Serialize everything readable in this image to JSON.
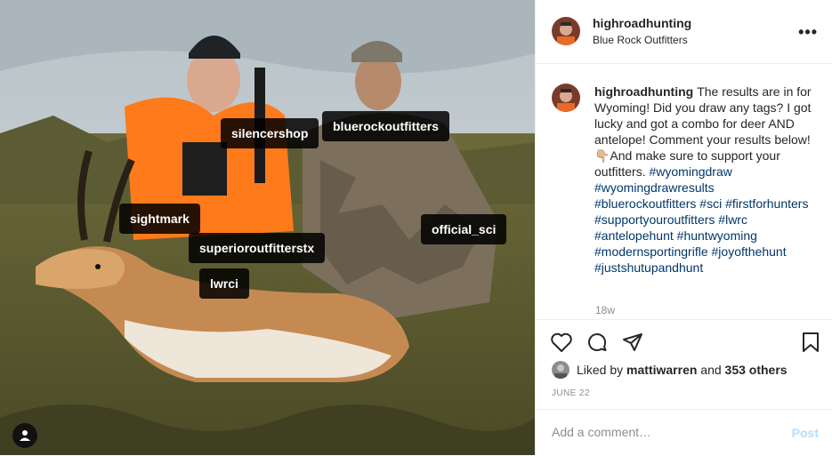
{
  "post": {
    "username": "highroadhunting",
    "location": "Blue Rock Outfitters",
    "more_label": "•••",
    "caption": {
      "username": "highroadhunting",
      "text": "The results are in for Wyoming! Did you draw any tags? I got lucky and got a combo for deer AND antelope! Comment your results below! 👇🏼And make sure to support your outfitters.",
      "hashtags": [
        "#wyomingdraw",
        "#wyomingdrawresults",
        "#bluerockoutfitters",
        "#sci",
        "#firstforhunters",
        "#supportyouroutfitters",
        "#lwrc",
        "#antelopehunt",
        "#huntwyoming",
        "#modernsportingrifle",
        "#joyofthehunt",
        "#justshutupandhunt"
      ],
      "age": "18w"
    },
    "likes": {
      "prefix": "Liked by",
      "user": "mattiwarren",
      "and": "and",
      "others": "353 others"
    },
    "date": "JUNE 22",
    "comment": {
      "placeholder": "Add a comment…",
      "post_label": "Post"
    }
  },
  "photo_tags": [
    "silencershop",
    "bluerockoutfitters",
    "sightmark",
    "official_sci",
    "superioroutfitterstx",
    "lwrci"
  ],
  "colors": {
    "link": "#00376b",
    "muted": "#8e8e8e",
    "post_disabled": "#b2dffc",
    "tag_bg": "#000000",
    "hunter_vest": "#ff7a1a"
  }
}
